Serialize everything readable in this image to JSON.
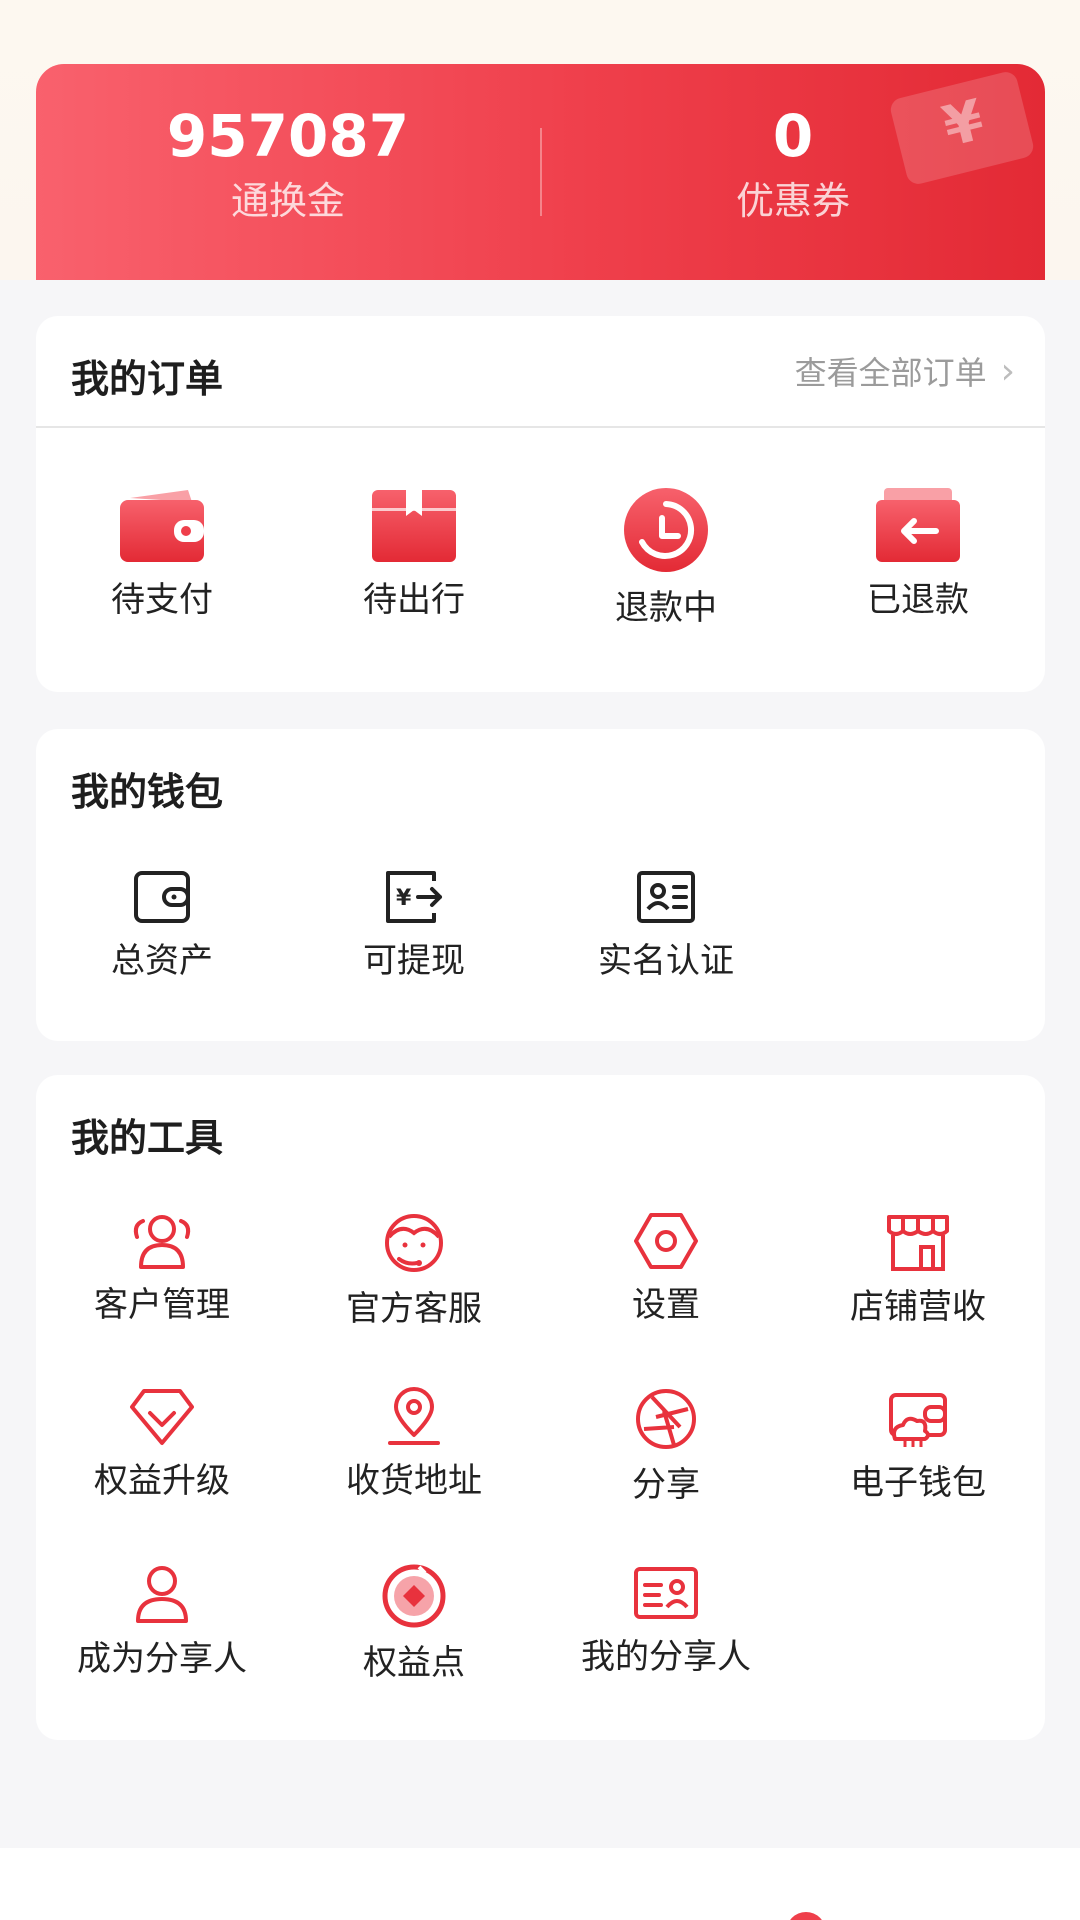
{
  "stats": {
    "points_value": "957087",
    "points_label": "通换金",
    "coupons_value": "0",
    "coupons_label": "优惠券",
    "ticket_symbol": "¥"
  },
  "orders": {
    "title": "我的订单",
    "view_all": "查看全部订单",
    "items": [
      {
        "label": "待支付",
        "icon": "wallet-icon"
      },
      {
        "label": "待出行",
        "icon": "package-icon"
      },
      {
        "label": "退款中",
        "icon": "clock-refresh-icon"
      },
      {
        "label": "已退款",
        "icon": "return-arrow-icon"
      }
    ]
  },
  "wallet": {
    "title": "我的钱包",
    "items": [
      {
        "label": "总资产",
        "icon": "wallet-outline-icon"
      },
      {
        "label": "可提现",
        "icon": "withdraw-icon"
      },
      {
        "label": "实名认证",
        "icon": "id-card-icon"
      }
    ]
  },
  "tools": {
    "title": "我的工具",
    "items": [
      {
        "label": "客户管理",
        "icon": "customers-icon"
      },
      {
        "label": "官方客服",
        "icon": "customer-service-icon"
      },
      {
        "label": "设置",
        "icon": "settings-icon"
      },
      {
        "label": "店铺营收",
        "icon": "store-icon"
      },
      {
        "label": "权益升级",
        "icon": "diamond-icon"
      },
      {
        "label": "收货地址",
        "icon": "location-pin-icon"
      },
      {
        "label": "分享",
        "icon": "share-aperture-icon"
      },
      {
        "label": "电子钱包",
        "icon": "e-wallet-icon"
      },
      {
        "label": "成为分享人",
        "icon": "user-icon"
      },
      {
        "label": "权益点",
        "icon": "points-coin-icon"
      },
      {
        "label": "我的分享人",
        "icon": "sharer-card-icon"
      }
    ]
  },
  "colors": {
    "accent": "#ef3f4b",
    "accent_light": "#f9616d"
  }
}
